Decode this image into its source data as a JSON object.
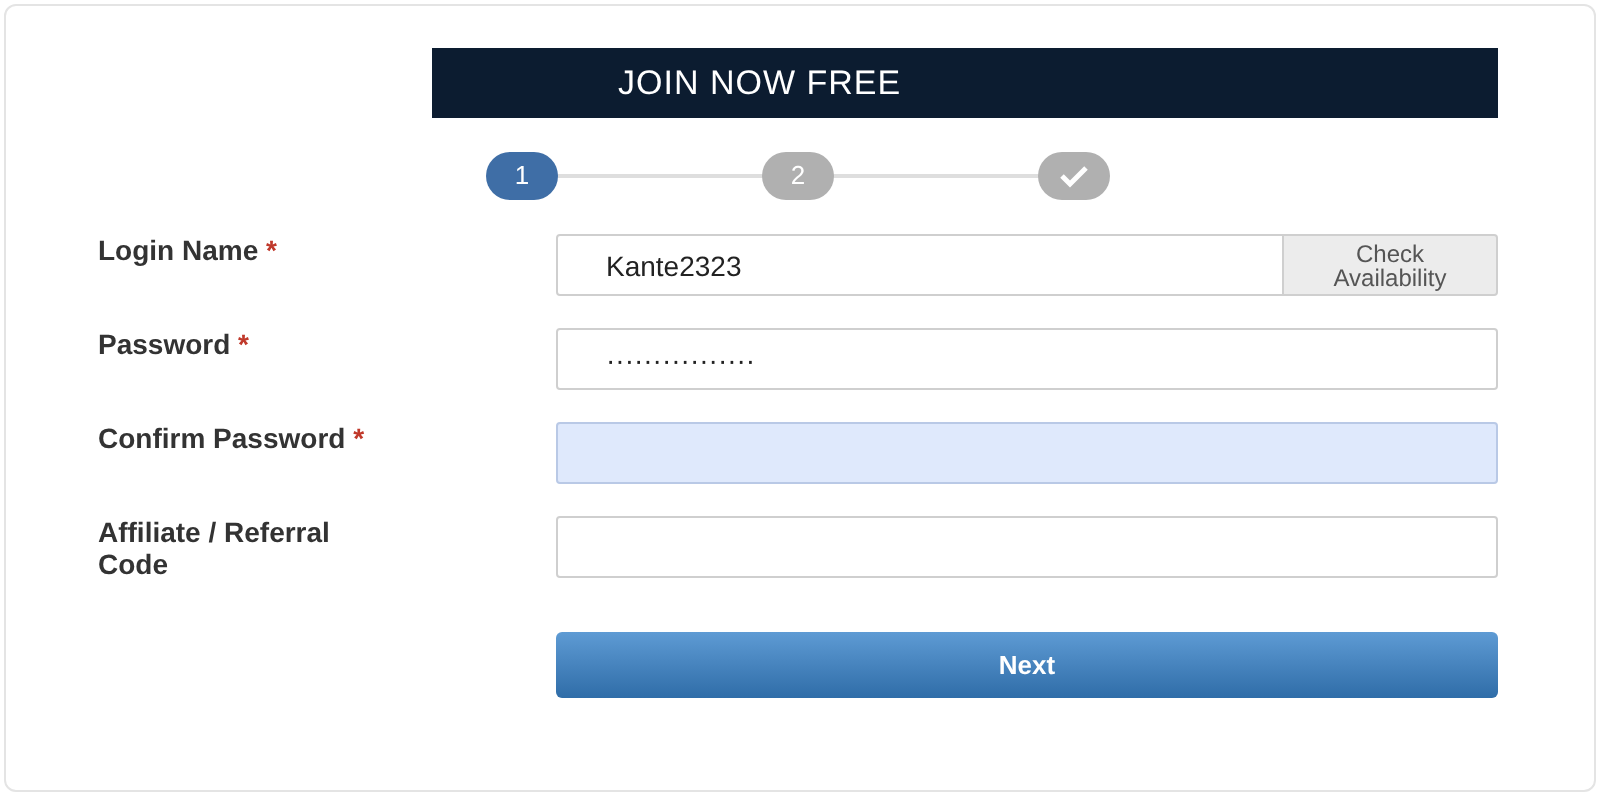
{
  "header": {
    "title": "JOIN NOW FREE"
  },
  "steps": [
    {
      "kind": "number",
      "label": "1",
      "selected": true
    },
    {
      "kind": "number",
      "label": "2",
      "selected": false
    },
    {
      "kind": "check",
      "selected": false
    }
  ],
  "fields": [
    {
      "label": "Login Name",
      "required": true,
      "value": "Kante2323",
      "highlighted": false,
      "button": "Check Availability"
    },
    {
      "label": "Password",
      "required": true,
      "value": "················",
      "highlighted": false
    },
    {
      "label": "Confirm Password",
      "required": true,
      "highlighted": true
    },
    {
      "label": "Affiliate / Referral Code",
      "required": false,
      "highlighted": false
    }
  ],
  "required_mark": "*",
  "next_button": "Next"
}
